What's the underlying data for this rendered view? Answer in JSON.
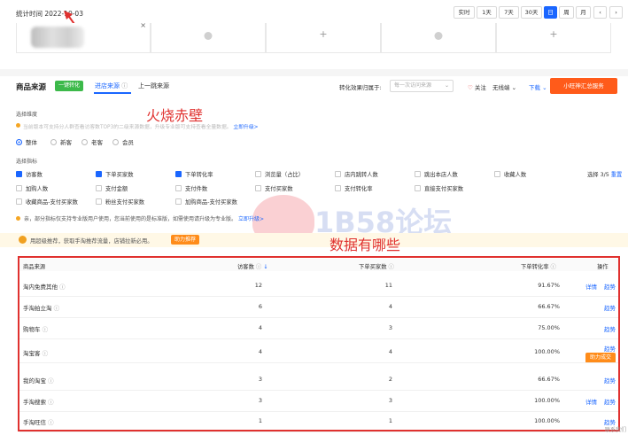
{
  "topbar": {
    "stat_time": "统计时间 2022-10-03",
    "periods": [
      {
        "label": "实时",
        "active": false
      },
      {
        "label": "1天",
        "active": false
      },
      {
        "label": "7天",
        "active": false
      },
      {
        "label": "30天",
        "active": false
      },
      {
        "label": "日",
        "active": true
      },
      {
        "label": "周",
        "active": false
      },
      {
        "label": "月",
        "active": false
      }
    ],
    "prev": "‹",
    "next": "›"
  },
  "cards": {
    "remove": "×",
    "add": "+"
  },
  "section": {
    "title": "商品来源",
    "one_click_convert": "一键转化",
    "tabs": [
      {
        "label": "进店来源",
        "active": true
      },
      {
        "label": "上一跳来源",
        "active": false
      }
    ],
    "attribution_label": "转化效果归属于:",
    "attribution_placeholder": "每一次访问来源",
    "follow": "关注",
    "no_dimension": "无线端",
    "download": "下载",
    "xiaowang_btn": "小旺神汇总服务"
  },
  "annotations": {
    "fire_wall": "火烧赤壁",
    "data_table": "数据有哪些"
  },
  "watermark": {
    "text": "1B58论坛",
    "url": "tb58.net"
  },
  "dimension": {
    "label": "选择维度",
    "hint": "当前版本可支持分人群查看访客数TOP3的二级来源数据，升级专业版可支持查看全量数据。",
    "upgrade": "立即升级>",
    "options": [
      {
        "label": "整体",
        "on": true
      },
      {
        "label": "新客",
        "on": false
      },
      {
        "label": "老客",
        "on": false
      },
      {
        "label": "会员",
        "on": false
      }
    ]
  },
  "indicators": {
    "label": "选择指标",
    "selected": "选择 3/5",
    "reset": "重置",
    "rows": [
      [
        {
          "label": "访客数",
          "on": true
        },
        {
          "label": "下单买家数",
          "on": true
        },
        {
          "label": "下单转化率",
          "on": true
        },
        {
          "label": "浏览量（占比）",
          "on": false
        },
        {
          "label": "店内跳转人数",
          "on": false
        },
        {
          "label": "跳出本店人数",
          "on": false
        },
        {
          "label": "收藏人数",
          "on": false
        }
      ],
      [
        {
          "label": "加购人数",
          "on": false
        },
        {
          "label": "支付金额",
          "on": false
        },
        {
          "label": "支付件数",
          "on": false
        },
        {
          "label": "支付买家数",
          "on": false
        },
        {
          "label": "支付转化率",
          "on": false
        },
        {
          "label": "直接支付买家数",
          "on": false
        }
      ],
      [
        {
          "label": "收藏商品-支付买家数",
          "on": false
        },
        {
          "label": "粉丝支付买家数",
          "on": false
        },
        {
          "label": "加购商品-支付买家数",
          "on": false
        }
      ]
    ]
  },
  "note": {
    "text": "亲，部分指标仅支持专业版用户使用，您当前使用的是标准版，如需使用请升级为专业版。",
    "link": "立即升级>"
  },
  "promo": {
    "text": "用超级推荐，获取手淘推荐流量，店铺拉新必用。",
    "button": "助力推荐"
  },
  "table": {
    "headers": {
      "source": "商品来源",
      "visitors": "访客数",
      "buyers": "下单买家数",
      "rate": "下单转化率",
      "action": "操作"
    },
    "sort_icon": "↓",
    "rows": [
      {
        "source": "淘内免费其他",
        "visitors": "12",
        "buyers": "11",
        "rate": "91.67%",
        "actions": [
          "详情",
          "趋势"
        ],
        "boost": ""
      },
      {
        "source": "手淘拍立淘",
        "visitors": "6",
        "buyers": "4",
        "rate": "66.67%",
        "actions": [
          "",
          "趋势"
        ],
        "boost": ""
      },
      {
        "source": "购物车",
        "visitors": "4",
        "buyers": "3",
        "rate": "75.00%",
        "actions": [
          "",
          "趋势"
        ],
        "boost": ""
      },
      {
        "source": "淘宝客",
        "visitors": "4",
        "buyers": "4",
        "rate": "100.00%",
        "actions": [
          "",
          "趋势"
        ],
        "boost": "助力成交"
      },
      {
        "source": "我的淘宝",
        "visitors": "3",
        "buyers": "2",
        "rate": "66.67%",
        "actions": [
          "",
          "趋势"
        ],
        "boost": ""
      },
      {
        "source": "手淘搜索",
        "visitors": "3",
        "buyers": "3",
        "rate": "100.00%",
        "actions": [
          "详情",
          "趋势"
        ],
        "boost": ""
      },
      {
        "source": "手淘旺信",
        "visitors": "1",
        "buyers": "1",
        "rate": "100.00%",
        "actions": [
          "",
          "趋势"
        ],
        "boost": ""
      }
    ]
  },
  "footer": {
    "text": "联系我们"
  }
}
